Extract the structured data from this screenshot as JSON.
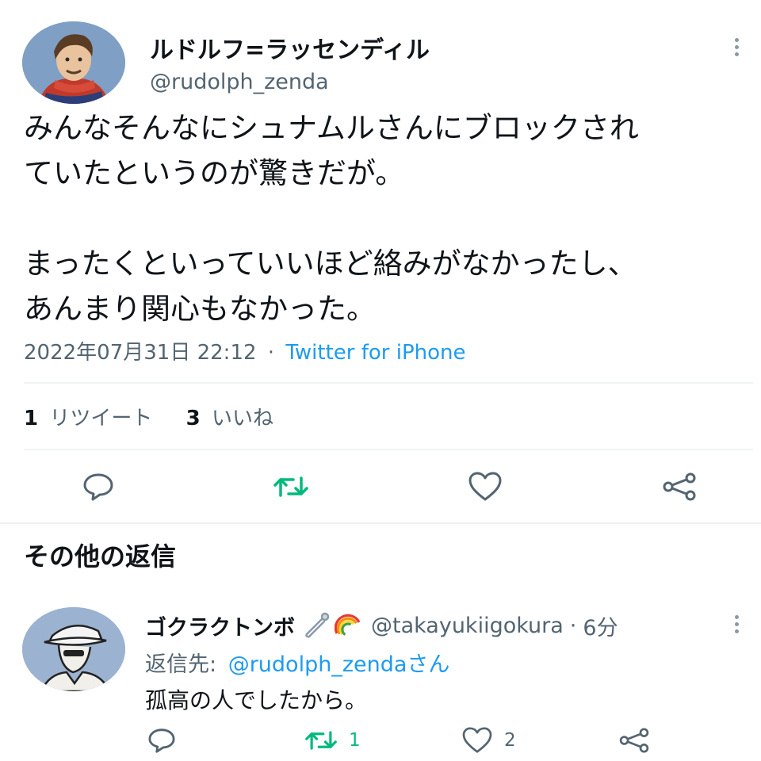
{
  "tweet": {
    "display_name": "ルドルフ=ラッセンディル",
    "handle": "@rudolph_zenda",
    "text_line1": "みんなそんなにシュナムルさんにブロックされ",
    "text_line2": "ていたというのが驚きだが。",
    "text_line3": "まったくといっていいほど絡みがなかったし、",
    "text_line4": "あんまり関心もなかった。",
    "timestamp": "2022年07月31日 22:12",
    "separator": "·",
    "source": "Twitter for iPhone",
    "retweet_count": "1",
    "retweet_label": "リツイート",
    "like_count": "3",
    "like_label": "いいね"
  },
  "replies_section": {
    "title": "その他の返信"
  },
  "reply": {
    "display_name": "ゴクラクトンボ",
    "handle": "@takayukiigokura",
    "separator": "·",
    "time": "6分",
    "reply_to_prefix": "返信先:",
    "reply_to_handle": "@rudolph_zenda",
    "reply_to_suffix": "さん",
    "text": "孤高の人でしたから。",
    "retweet_count": "1",
    "like_count": "2"
  },
  "colors": {
    "accent": "#1d9bf0",
    "retweet_active": "#00ba7c",
    "muted": "#536471"
  },
  "icons": [
    "more-icon",
    "reply-icon",
    "retweet-icon",
    "like-icon",
    "share-icon",
    "safety-pin-emoji",
    "rainbow-emoji"
  ]
}
